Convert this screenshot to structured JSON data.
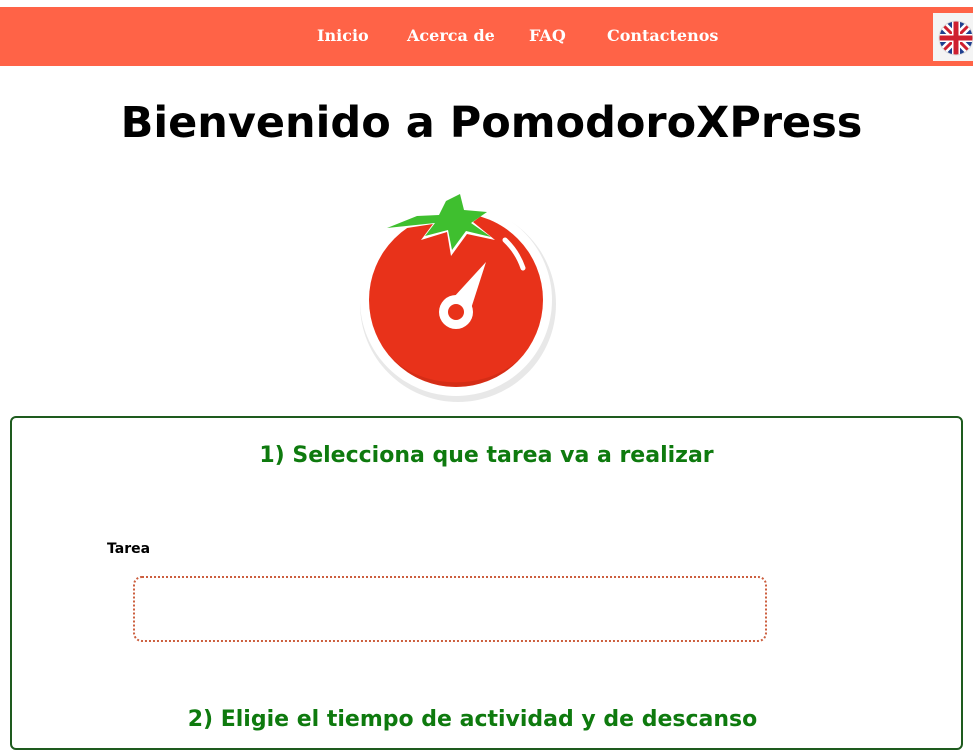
{
  "nav": {
    "items": [
      {
        "label": "Inicio"
      },
      {
        "label": "Acerca de"
      },
      {
        "label": "FAQ"
      },
      {
        "label": "Contactenos"
      }
    ],
    "language_icon": "uk-flag-icon"
  },
  "header": {
    "title": "Bienvenido a PomodoroXPress"
  },
  "logo": {
    "icon": "tomato-timer-logo"
  },
  "form": {
    "step1_title": "1) Selecciona que tarea va a realizar",
    "task_label": "Tarea",
    "task_value": "",
    "task_placeholder": "",
    "step2_title": "2) Eligie el tiempo de actividad y de descanso"
  },
  "colors": {
    "topbar": "#ff6347",
    "step_title": "#0e7a0e",
    "panel_border": "#1e5b1e",
    "input_border": "#cc5f3f",
    "tomato": "#e8321a",
    "leaf": "#3fbf2f"
  }
}
